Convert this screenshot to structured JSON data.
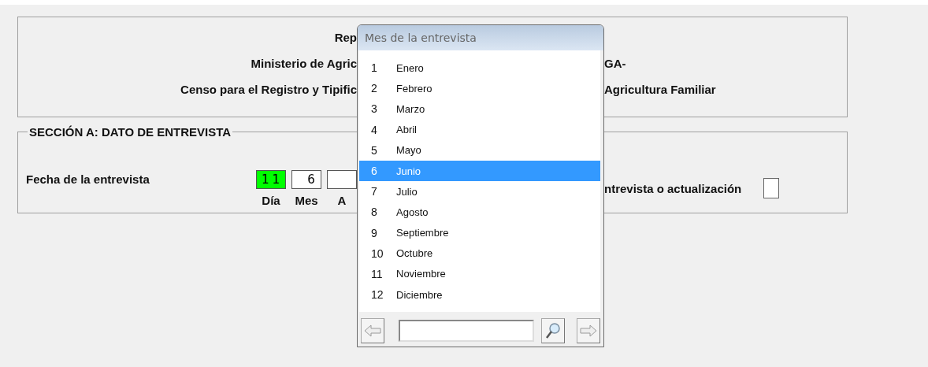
{
  "header": {
    "lines": [
      {
        "left": "Rep"
      },
      {
        "left": "Ministerio de Agric",
        "right": "GA-"
      },
      {
        "left": "Censo para el Registro y Tipific",
        "right": "Agricultura Familiar"
      }
    ]
  },
  "section": {
    "title": "SECCIÓN A: DATO DE ENTREVISTA",
    "date_label": "Fecha de la entrevista",
    "date_fields": [
      {
        "label": "Día",
        "value": "11",
        "focused": true
      },
      {
        "label": "Mes",
        "value": "6",
        "focused": false
      },
      {
        "label": "A",
        "focused": false
      }
    ],
    "right_label": "ntrevista o actualización",
    "right_checked": false
  },
  "popup": {
    "title": "Mes de la entrevista",
    "items": [
      {
        "code": "1",
        "name": "Enero",
        "selected": false
      },
      {
        "code": "2",
        "name": "Febrero",
        "selected": false
      },
      {
        "code": "3",
        "name": "Marzo",
        "selected": false
      },
      {
        "code": "4",
        "name": "Abril",
        "selected": false
      },
      {
        "code": "5",
        "name": "Mayo",
        "selected": false
      },
      {
        "code": "6",
        "name": "Junio",
        "selected": true
      },
      {
        "code": "7",
        "name": "Julio",
        "selected": false
      },
      {
        "code": "8",
        "name": "Agosto",
        "selected": false
      },
      {
        "code": "9",
        "name": "Septiembre",
        "selected": false
      },
      {
        "code": "10",
        "name": "Octubre",
        "selected": false
      },
      {
        "code": "11",
        "name": "Noviembre",
        "selected": false
      },
      {
        "code": "12",
        "name": "Diciembre",
        "selected": false
      }
    ]
  }
}
